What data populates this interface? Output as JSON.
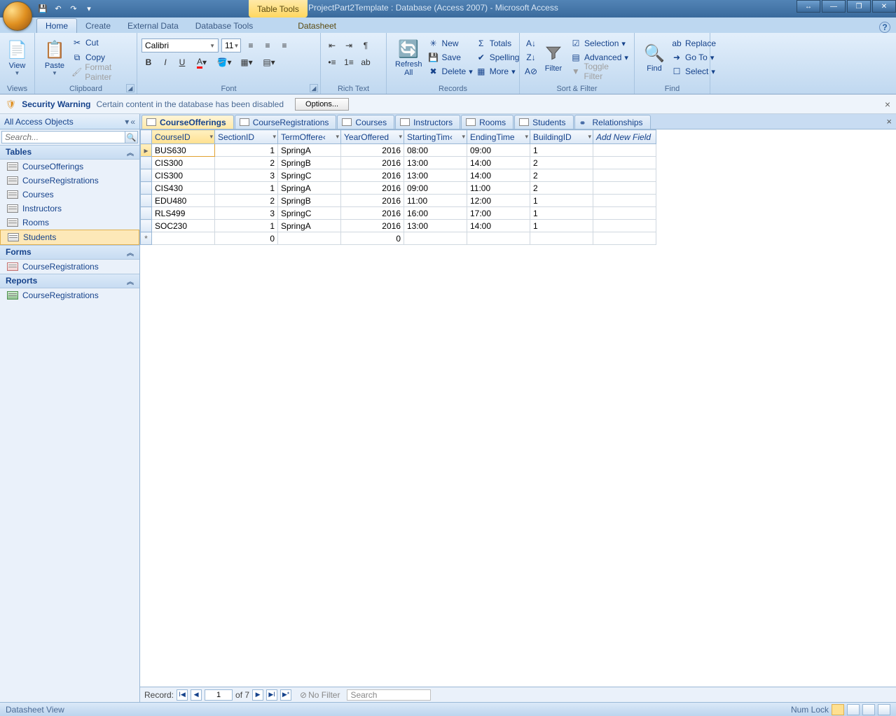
{
  "titlebar": {
    "contextual_tool": "Table Tools",
    "title_db": "ProjectPart2Template : Database (Access 2007)",
    "title_app": "Microsoft Access"
  },
  "ribbon_tabs": {
    "home": "Home",
    "create": "Create",
    "external_data": "External Data",
    "database_tools": "Database Tools",
    "datasheet": "Datasheet"
  },
  "ribbon": {
    "views": {
      "view": "View",
      "group": "Views"
    },
    "clipboard": {
      "paste": "Paste",
      "cut": "Cut",
      "copy": "Copy",
      "format_painter": "Format Painter",
      "group": "Clipboard"
    },
    "font": {
      "name": "Calibri",
      "size": "11",
      "group": "Font"
    },
    "richtext": {
      "group": "Rich Text"
    },
    "records": {
      "refresh": "Refresh\nAll",
      "new": "New",
      "save": "Save",
      "delete": "Delete",
      "totals": "Totals",
      "spelling": "Spelling",
      "more": "More",
      "group": "Records"
    },
    "sortfilter": {
      "filter": "Filter",
      "selection": "Selection",
      "advanced": "Advanced",
      "toggle": "Toggle Filter",
      "group": "Sort & Filter"
    },
    "find": {
      "find": "Find",
      "replace": "Replace",
      "goto": "Go To",
      "select": "Select",
      "group": "Find"
    }
  },
  "security": {
    "label": "Security Warning",
    "message": "Certain content in the database has been disabled",
    "button": "Options..."
  },
  "navpane": {
    "header": "All Access Objects",
    "search_placeholder": "Search...",
    "groups": {
      "tables": "Tables",
      "forms": "Forms",
      "reports": "Reports"
    },
    "tables": [
      "CourseOfferings",
      "CourseRegistrations",
      "Courses",
      "Instructors",
      "Rooms",
      "Students"
    ],
    "forms": [
      "CourseRegistrations"
    ],
    "reports": [
      "CourseRegistrations"
    ],
    "selected_table": "Students"
  },
  "doc_tabs": [
    "CourseOfferings",
    "CourseRegistrations",
    "Courses",
    "Instructors",
    "Rooms",
    "Students",
    "Relationships"
  ],
  "active_tab": "CourseOfferings",
  "datasheet": {
    "columns": [
      "CourseID",
      "SectionID",
      "TermOffered",
      "YearOffered",
      "StartingTime",
      "EndingTime",
      "BuildingID"
    ],
    "add_field": "Add New Field",
    "rows": [
      {
        "CourseID": "BUS630",
        "SectionID": "1",
        "TermOffered": "SpringA",
        "YearOffered": "2016",
        "StartingTime": "08:00",
        "EndingTime": "09:00",
        "BuildingID": "1"
      },
      {
        "CourseID": "CIS300",
        "SectionID": "2",
        "TermOffered": "SpringB",
        "YearOffered": "2016",
        "StartingTime": "13:00",
        "EndingTime": "14:00",
        "BuildingID": "2"
      },
      {
        "CourseID": "CIS300",
        "SectionID": "3",
        "TermOffered": "SpringC",
        "YearOffered": "2016",
        "StartingTime": "13:00",
        "EndingTime": "14:00",
        "BuildingID": "2"
      },
      {
        "CourseID": "CIS430",
        "SectionID": "1",
        "TermOffered": "SpringA",
        "YearOffered": "2016",
        "StartingTime": "09:00",
        "EndingTime": "11:00",
        "BuildingID": "2"
      },
      {
        "CourseID": "EDU480",
        "SectionID": "2",
        "TermOffered": "SpringB",
        "YearOffered": "2016",
        "StartingTime": "11:00",
        "EndingTime": "12:00",
        "BuildingID": "1"
      },
      {
        "CourseID": "RLS499",
        "SectionID": "3",
        "TermOffered": "SpringC",
        "YearOffered": "2016",
        "StartingTime": "16:00",
        "EndingTime": "17:00",
        "BuildingID": "1"
      },
      {
        "CourseID": "SOC230",
        "SectionID": "1",
        "TermOffered": "SpringA",
        "YearOffered": "2016",
        "StartingTime": "13:00",
        "EndingTime": "14:00",
        "BuildingID": "1"
      }
    ],
    "new_row": {
      "SectionID": "0",
      "YearOffered": "0"
    }
  },
  "recnav": {
    "label": "Record:",
    "current": "1",
    "of": "of 7",
    "nofilter": "No Filter",
    "search": "Search"
  },
  "statusbar": {
    "left": "Datasheet View",
    "numlock": "Num Lock"
  }
}
